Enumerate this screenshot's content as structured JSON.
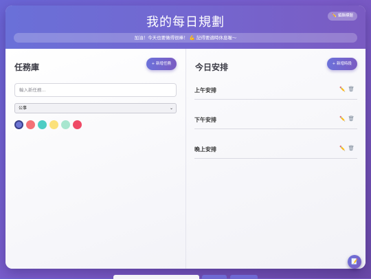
{
  "header": {
    "title": "我的每日規劃",
    "edit_button_label": "編輯標題",
    "motto": "加油！今天也要做得很棒！ 💪 記得要適時休息喔～"
  },
  "task_library": {
    "title": "任務庫",
    "add_button_label": "+ 新增任務",
    "input_placeholder": "輸入新任務...",
    "category_selected": "公事",
    "colors": [
      "#6d75d4",
      "#f47176",
      "#4ecdc4",
      "#fbe17a",
      "#a8e6cf",
      "#ef4a66"
    ]
  },
  "schedule": {
    "title": "今日安排",
    "add_button_label": "+ 新增時段",
    "slots": [
      {
        "label": "上午安排"
      },
      {
        "label": "下午安排"
      },
      {
        "label": "晚上安排"
      }
    ]
  },
  "icons": {
    "edit": "pencil-icon",
    "delete": "trash-icon",
    "fab": "note-icon"
  }
}
